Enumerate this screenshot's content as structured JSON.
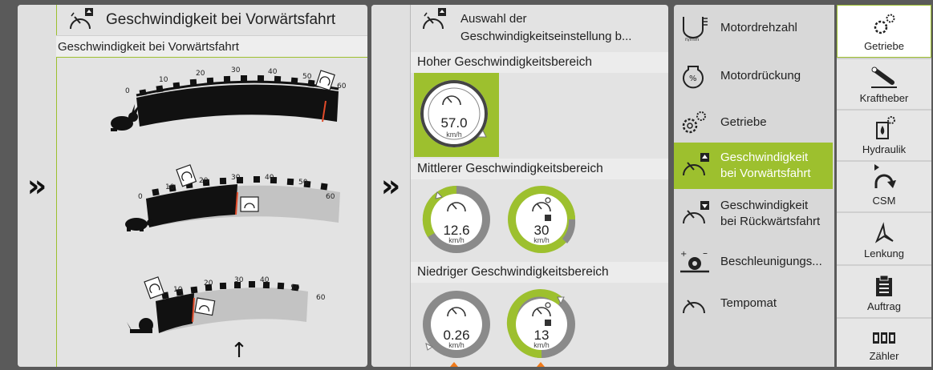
{
  "left": {
    "title": "Geschwindigkeit bei Vorwärtsfahrt",
    "subtitle": "Geschwindigkeit bei Vorwärtsfahrt",
    "expand_glyph": "»",
    "gauges": [
      {
        "mode": "hase",
        "ticks": [
          "0",
          "10",
          "20",
          "30",
          "40",
          "50",
          "60"
        ],
        "value": 60
      },
      {
        "mode": "schildkroete",
        "ticks": [
          "0",
          "10",
          "20",
          "30",
          "40",
          "50",
          "60"
        ],
        "value": 30
      },
      {
        "mode": "schnecke",
        "ticks": [
          "0",
          "10",
          "20",
          "30",
          "40",
          "50",
          "60"
        ],
        "value": 13
      }
    ],
    "arrow_glyph": "↑"
  },
  "middle": {
    "expand_glyph": "»",
    "title_line1": "Auswahl der",
    "title_line2": "Geschwindigkeitseinstellung b...",
    "sections": [
      {
        "label": "Hoher Geschwindigkeitsbereich",
        "dials": [
          {
            "value": "57.0",
            "unit": "km/h"
          }
        ]
      },
      {
        "label": "Mittlerer Geschwindigkeitsbereich",
        "dials": [
          {
            "value": "12.6",
            "unit": "km/h"
          },
          {
            "value": "30",
            "unit": "km/h"
          }
        ]
      },
      {
        "label": "Niedriger Geschwindigkeitsbereich",
        "dials": [
          {
            "value": "0.26",
            "unit": "km/h"
          },
          {
            "value": "13",
            "unit": "km/h"
          }
        ]
      }
    ]
  },
  "menu": {
    "items": [
      {
        "label1": "Motordrehzahl",
        "label2": "",
        "icon": "engine-speed-icon",
        "sub": "n/min"
      },
      {
        "label1": "Motordrückung",
        "label2": "",
        "icon": "engine-load-icon"
      },
      {
        "label1": "Getriebe",
        "label2": "",
        "icon": "gears-icon"
      },
      {
        "label1": "Geschwindigkeit",
        "label2": "bei Vorwärtsfahrt",
        "icon": "forward-speed-icon",
        "selected": true
      },
      {
        "label1": "Geschwindigkeit",
        "label2": "bei Rückwärtsfahrt",
        "icon": "reverse-speed-icon"
      },
      {
        "label1": "Beschleunigungs...",
        "label2": "",
        "icon": "acceleration-icon"
      },
      {
        "label1": "Tempomat",
        "label2": "",
        "icon": "cruise-control-icon"
      }
    ]
  },
  "tabs": [
    {
      "label": "Getriebe",
      "icon": "gears-icon",
      "active": true
    },
    {
      "label": "Kraftheber",
      "icon": "hitch-icon"
    },
    {
      "label": "Hydraulik",
      "icon": "hydraulics-icon"
    },
    {
      "label": "CSM",
      "icon": "csm-icon"
    },
    {
      "label": "Lenkung",
      "icon": "steering-icon"
    },
    {
      "label": "Auftrag",
      "icon": "clipboard-icon"
    },
    {
      "label": "Zähler",
      "icon": "counter-icon"
    }
  ],
  "colors": {
    "accent": "#9dc02e",
    "panel": "#e3e3e3",
    "bezel": "#5a5a5a",
    "gauge_black": "#111111",
    "gauge_grey": "#c0c0c0"
  }
}
